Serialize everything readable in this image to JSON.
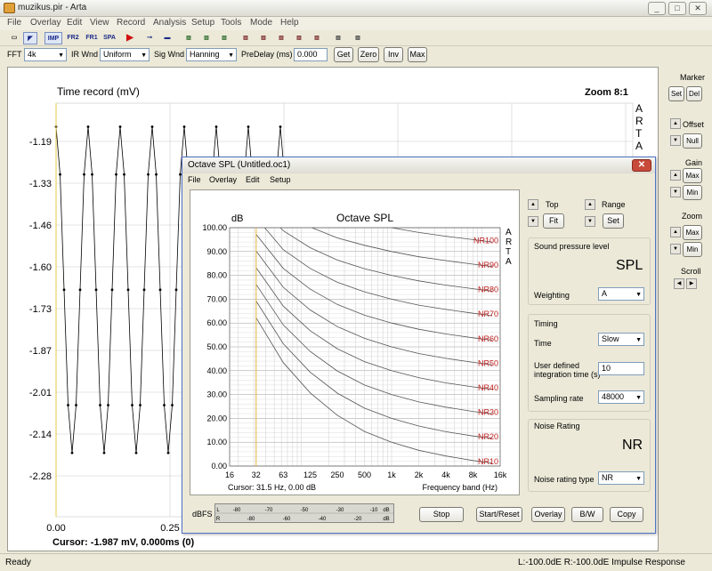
{
  "window": {
    "title": "muzikus.pir - Arta",
    "min": "_",
    "max": "□",
    "close": "✕"
  },
  "menu": [
    "File",
    "Overlay",
    "Edit",
    "View",
    "Record",
    "Analysis",
    "Setup",
    "Tools",
    "Mode",
    "Help"
  ],
  "toolbar1": [
    "IMP",
    "FR2",
    "FR1",
    "SPA"
  ],
  "toolbar2": {
    "fft_label": "FFT",
    "fft_value": "4k",
    "irwnd_label": "IR Wnd",
    "irwnd_value": "Uniform",
    "sigwnd_label": "Sig Wnd",
    "sigwnd_value": "Hanning",
    "predelay_label": "PreDelay (ms)",
    "predelay_value": "0.000",
    "buttons": [
      "Get",
      "Zero",
      "Inv",
      "Max"
    ]
  },
  "main_plot": {
    "title": "Time record (mV)",
    "zoom": "Zoom 8:1",
    "arta": [
      "A",
      "R",
      "T",
      "A"
    ],
    "y_ticks": [
      "-1.19",
      "-1.33",
      "-1.46",
      "-1.60",
      "-1.73",
      "-1.87",
      "-2.01",
      "-2.14",
      "-2.28"
    ],
    "x_ticks": [
      "0.00",
      "0.25"
    ],
    "cursor": "Cursor: -1.987 mV, 0.000ms (0)"
  },
  "right_panel": {
    "marker": {
      "label": "Marker",
      "set": "Set",
      "del": "Del"
    },
    "offset": {
      "label": "Offset",
      "null": "Null"
    },
    "gain": {
      "label": "Gain",
      "max": "Max",
      "min": "Min"
    },
    "zoom": {
      "label": "Zoom",
      "max": "Max",
      "min": "Min"
    },
    "scroll": {
      "label": "Scroll"
    }
  },
  "dialog": {
    "title": "Octave SPL (Untitled.oc1)",
    "menu": [
      "File",
      "Overlay",
      "Edit",
      "Setup"
    ],
    "plot": {
      "title": "Octave SPL",
      "ylabel": "dB",
      "xlabel": "Frequency band (Hz)",
      "cursor": "Cursor:  31.5 Hz, 0.00 dB",
      "arta": [
        "A",
        "R",
        "T",
        "A"
      ]
    },
    "top_label": "Top",
    "fit": "Fit",
    "range_label": "Range",
    "set": "Set",
    "spl_group": "Sound pressure level",
    "spl_big": "SPL",
    "weighting_label": "Weighting",
    "weighting_value": "A",
    "timing_group": "Timing",
    "time_label": "Time",
    "time_value": "Slow",
    "integ_label1": "User defined",
    "integ_label2": "integration time (s)",
    "integ_value": "10",
    "sampling_label": "Sampling rate",
    "sampling_value": "48000",
    "nr_group": "Noise Rating",
    "nr_big": "NR",
    "nr_type_label": "Noise rating type",
    "nr_type_value": "NR",
    "dbfs": "dBFS",
    "meter_top": [
      "L",
      "-80",
      "-70",
      "-50",
      "-30",
      "-10",
      "dB"
    ],
    "meter_bot": [
      "R",
      "-80",
      "-60",
      "-40",
      "-20",
      "dB"
    ],
    "buttons": {
      "stop": "Stop",
      "startreset": "Start/Reset",
      "overlay": "Overlay",
      "bw": "B/W",
      "copy": "Copy"
    }
  },
  "chart_data": {
    "type": "line",
    "title": "Octave SPL",
    "ylabel": "dB",
    "xlabel": "Frequency band (Hz)",
    "ylim": [
      0,
      100
    ],
    "y_ticks": [
      "100.00",
      "90.00",
      "80.00",
      "70.00",
      "60.00",
      "50.00",
      "40.00",
      "30.00",
      "20.00",
      "10.00",
      "0.00"
    ],
    "x_ticks": [
      "16",
      "32",
      "63",
      "125",
      "250",
      "500",
      "1k",
      "2k",
      "4k",
      "8k",
      "16k"
    ],
    "x": [
      31.5,
      63,
      125,
      250,
      500,
      1000,
      2000,
      4000,
      8000
    ],
    "series": [
      {
        "name": "NR10",
        "values": [
          62.2,
          43.4,
          30.7,
          21.3,
          14.5,
          10,
          6.6,
          4.2,
          2.3
        ]
      },
      {
        "name": "NR20",
        "values": [
          69.2,
          51.3,
          39.4,
          30.6,
          24.3,
          20,
          16.8,
          14.4,
          12.6
        ]
      },
      {
        "name": "NR30",
        "values": [
          76.2,
          59.2,
          48.1,
          39.9,
          34,
          30,
          26.9,
          24.7,
          22.9
        ]
      },
      {
        "name": "NR40",
        "values": [
          83.2,
          67.1,
          56.8,
          49.2,
          43.8,
          40,
          37.1,
          34.9,
          33.2
        ]
      },
      {
        "name": "NR50",
        "values": [
          90.2,
          75,
          65.5,
          58.5,
          53.6,
          50,
          47.2,
          45.2,
          43.5
        ]
      },
      {
        "name": "NR60",
        "values": [
          97.2,
          82.9,
          74.2,
          67.8,
          63.3,
          60,
          57.4,
          55.4,
          53.8
        ]
      },
      {
        "name": "NR70",
        "values": [
          104.2,
          90.8,
          82.9,
          77.1,
          73.1,
          70,
          67.5,
          65.7,
          64.1
        ]
      },
      {
        "name": "NR80",
        "values": [
          111.2,
          98.7,
          91.6,
          86.4,
          82.8,
          80,
          77.7,
          75.9,
          74.4
        ]
      },
      {
        "name": "NR90",
        "values": [
          118.2,
          106.6,
          100.3,
          95.7,
          92.6,
          90,
          87.8,
          86.2,
          84.7
        ]
      },
      {
        "name": "NR100",
        "values": [
          125.2,
          114.5,
          109,
          105,
          102.3,
          100,
          98,
          96.4,
          95
        ]
      }
    ],
    "cursor_x": 31.5
  },
  "time_chart": {
    "type": "line",
    "ylim": [
      -2.35,
      -1.12
    ],
    "x_ticks": [
      "0.00",
      "0.25"
    ],
    "cursor_x": 0.0,
    "peak": -1.19,
    "trough": -2.16
  },
  "status": {
    "left": "Ready",
    "right": "L:-100.0dE  R:-100.0dE  Impulse Response"
  }
}
